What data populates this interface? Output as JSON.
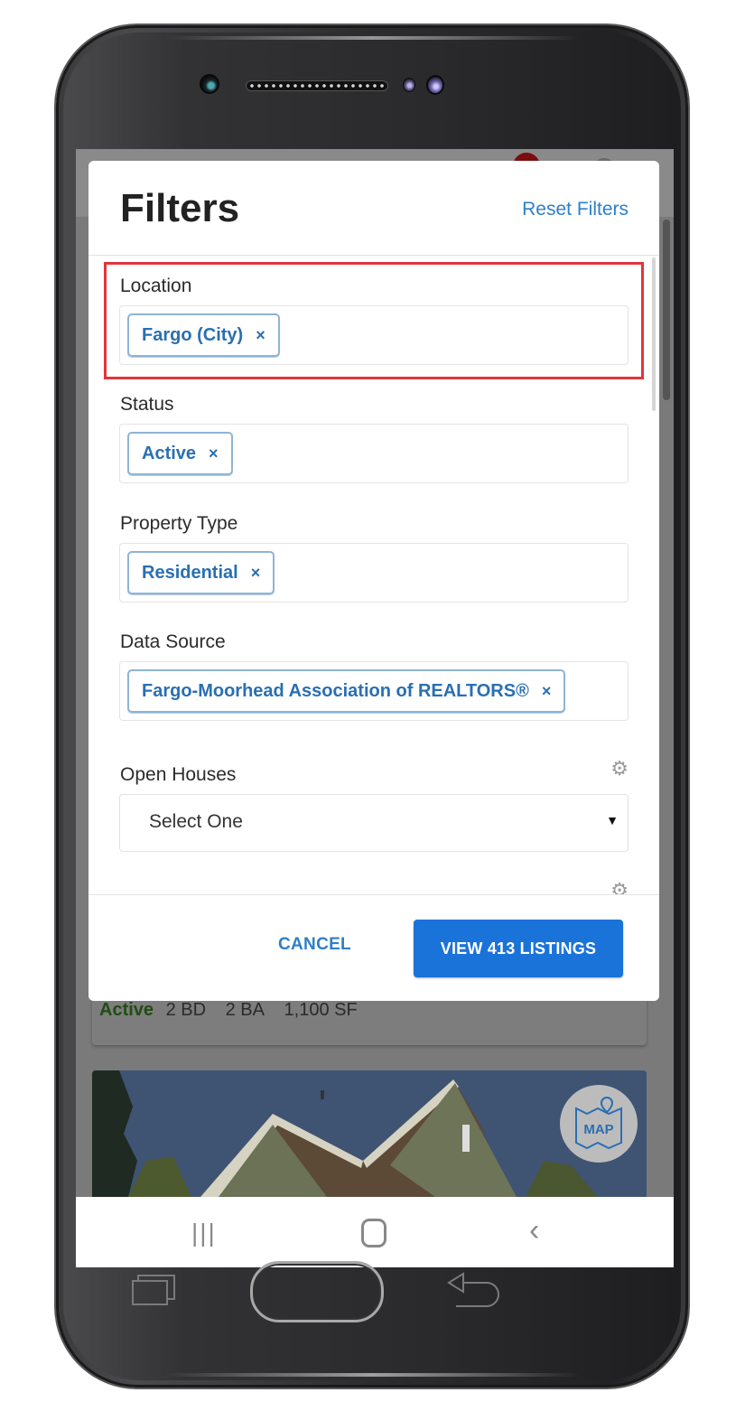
{
  "modal": {
    "title": "Filters",
    "reset_label": "Reset Filters",
    "fields": {
      "location": {
        "label": "Location",
        "tags": [
          "Fargo (City)"
        ]
      },
      "status": {
        "label": "Status",
        "tags": [
          "Active"
        ]
      },
      "property_type": {
        "label": "Property Type",
        "tags": [
          "Residential"
        ]
      },
      "data_source": {
        "label": "Data Source",
        "tags": [
          "Fargo-Moorhead Association of REALTORS®"
        ]
      },
      "open_houses": {
        "label": "Open Houses",
        "selected": "Select One"
      }
    },
    "tag_remove_glyph": "×",
    "cancel_label": "CANCEL",
    "view_label": "VIEW 413 LISTINGS"
  },
  "background_listing": {
    "status": "Active",
    "beds": "2 BD",
    "baths": "2 BA",
    "sqft": "1,100 SF",
    "map_button_label": "MAP"
  },
  "icons": {
    "gear": "⚙",
    "caret": "▼",
    "nav_recent": "|||",
    "nav_back": "‹"
  },
  "colors": {
    "accent": "#1a73d9",
    "link": "#2e7fc8",
    "highlight": "#e0353a",
    "tag_text": "#2a6fb2"
  }
}
